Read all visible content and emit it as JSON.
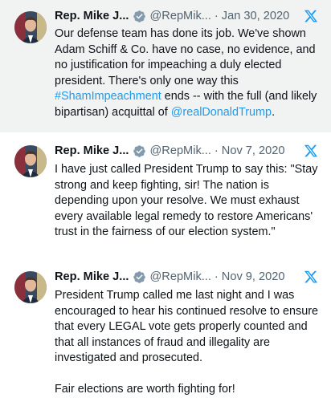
{
  "tweets": [
    {
      "name": "Rep. Mike J...",
      "handle": "@RepMik...",
      "separator": "·",
      "date": "Jan 30, 2020",
      "text_a": "Our defense team has done its job. We've shown Adam Schiff & Co. have no case, no evidence, and no justification for impeaching a duly elected president. There's only one way this ",
      "hashtag": "#ShamImpeachment",
      "text_b": " ends -- with the full (and likely bipartisan) acquittal of ",
      "mention": "@realDonaldTrump",
      "text_c": "."
    },
    {
      "name": "Rep. Mike J...",
      "handle": "@RepMik...",
      "separator": "·",
      "date": "Nov 7, 2020",
      "text": "I have just called President Trump to say this: \"Stay strong and keep fighting, sir! The nation is depending upon your resolve. We must exhaust every available legal remedy to restore Americans' trust in the fairness of our election system.\""
    },
    {
      "name": "Rep. Mike J...",
      "handle": "@RepMik...",
      "separator": "·",
      "date": "Nov 9, 2020",
      "text": "President Trump called me last night and I was encouraged to hear his continued resolve to ensure that every LEGAL vote gets properly counted and that all instances of fraud and illegality are investigated and prosecuted.\n\nFair elections are worth fighting for!"
    }
  ],
  "colors": {
    "link": "#1d9bf0",
    "verified": "#829aab",
    "x_logo": "#1d9bf0",
    "secondary_text": "#536471"
  },
  "icons": {
    "avatar": "profile-photo",
    "verified": "verified-badge-icon",
    "platform": "x-logo-icon"
  }
}
